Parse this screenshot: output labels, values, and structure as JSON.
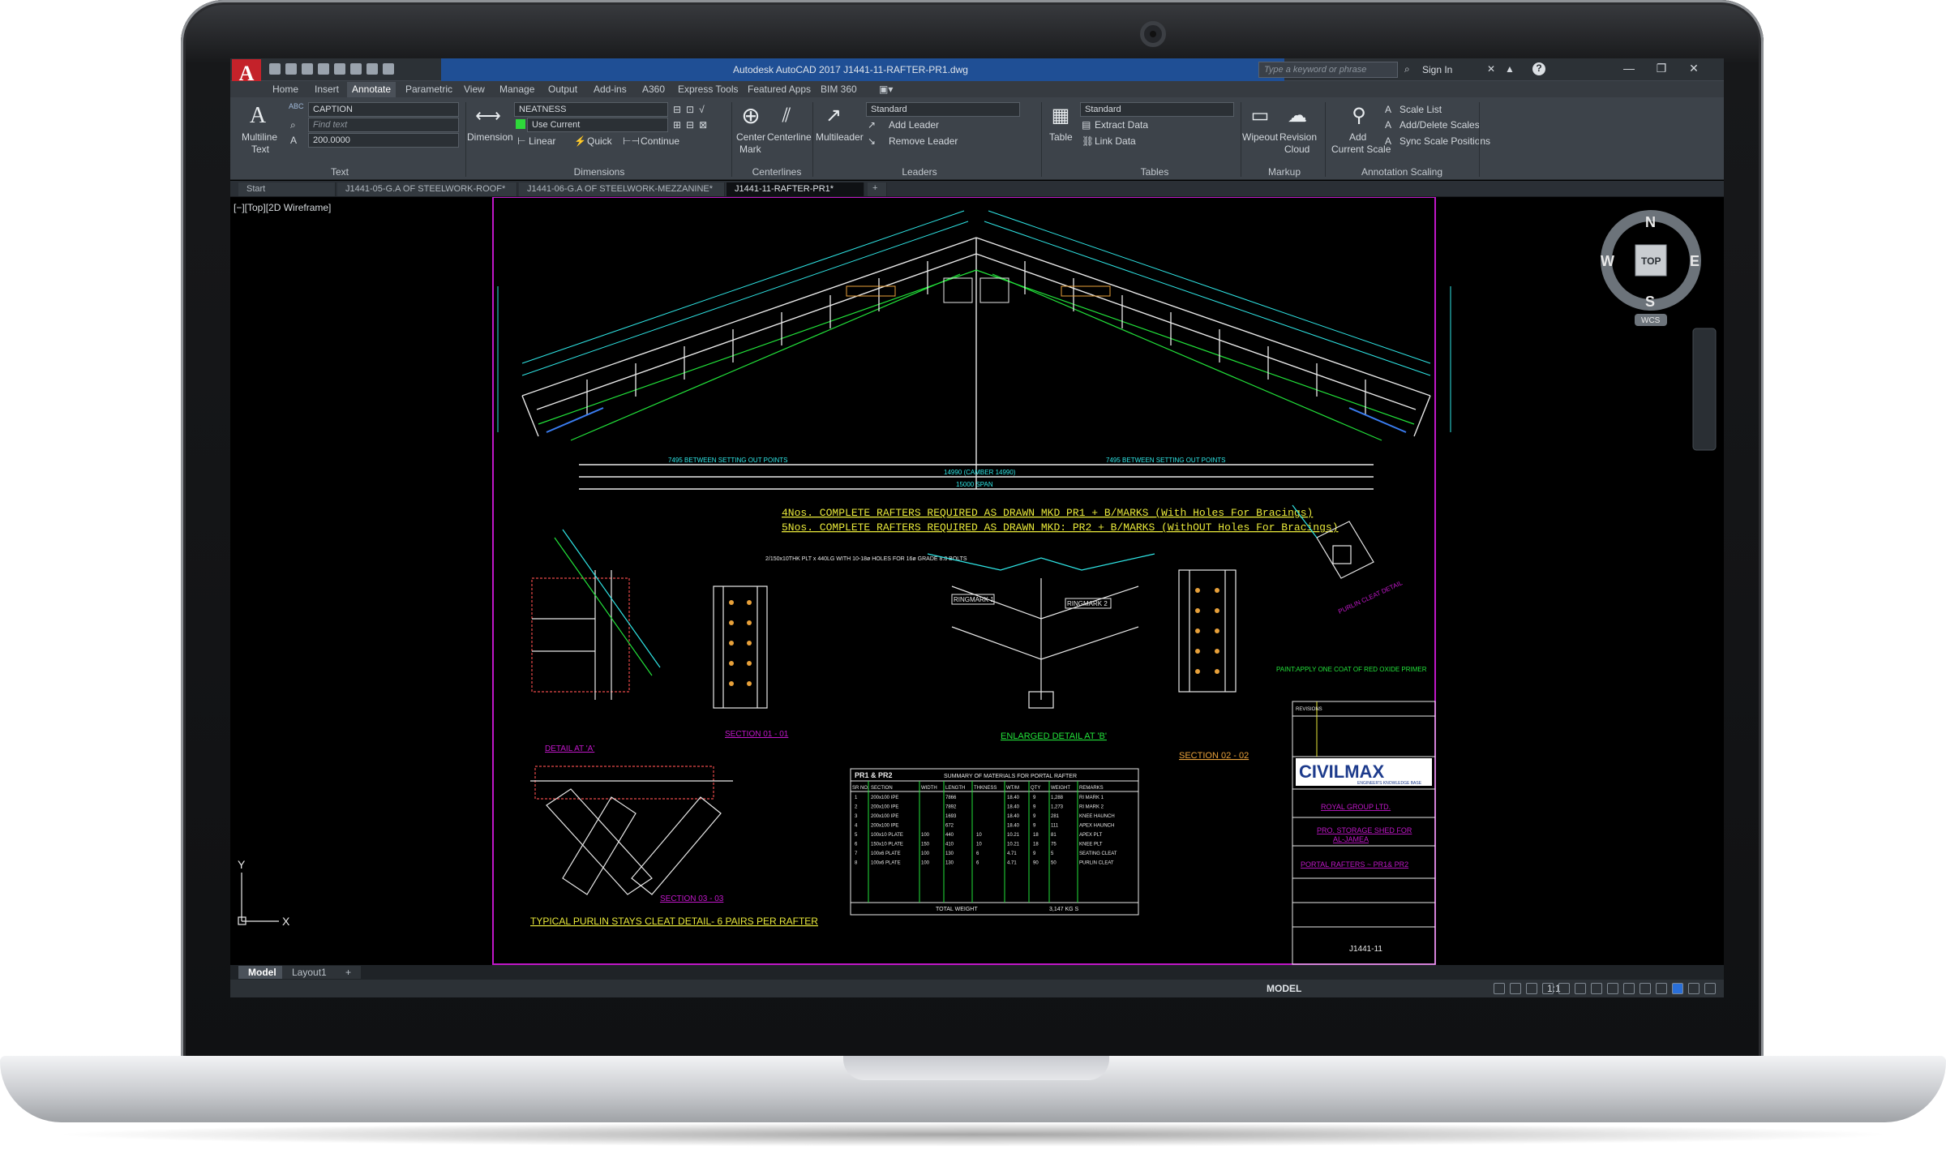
{
  "app": {
    "logo": "A",
    "title": "Autodesk AutoCAD 2017   J1441-11-RAFTER-PR1.dwg",
    "search_placeholder": "Type a keyword or phrase",
    "sign_in": "Sign In",
    "help": "?"
  },
  "menu_tabs": [
    "Home",
    "Insert",
    "Annotate",
    "Parametric",
    "View",
    "Manage",
    "Output",
    "Add-ins",
    "A360",
    "Express Tools",
    "Featured Apps",
    "BIM 360"
  ],
  "ribbon": {
    "text": {
      "multiline": "Multiline",
      "text": "Text",
      "style": "CAPTION",
      "find": "Find text",
      "height": "200.0000",
      "label": "Text"
    },
    "dimensions": {
      "dimension": "Dimension",
      "style": "NEATNESS",
      "layer": "Use Current",
      "linear": "Linear",
      "quick": "Quick",
      "continue": "Continue",
      "label": "Dimensions"
    },
    "centerlines": {
      "center_mark": "Center",
      "mark": "Mark",
      "centerline": "Centerline",
      "label": "Centerlines"
    },
    "leaders": {
      "multileader": "Multileader",
      "style": "Standard",
      "add": "Add Leader",
      "remove": "Remove Leader",
      "label": "Leaders"
    },
    "tables": {
      "table": "Table",
      "style": "Standard",
      "extract": "Extract Data",
      "link": "Link Data",
      "label": "Tables"
    },
    "markup": {
      "wipeout": "Wipeout",
      "revision": "Revision",
      "cloud": "Cloud",
      "label": "Markup"
    },
    "scaling": {
      "add": "Add",
      "current_scale": "Current Scale",
      "scale_list": "Scale List",
      "add_delete": "Add/Delete Scales",
      "sync": "Sync Scale Positions",
      "label": "Annotation Scaling"
    }
  },
  "doc_tabs": [
    "Start",
    "J1441-05-G.A OF STEELWORK-ROOF*",
    "J1441-06-G.A OF STEELWORK-MEZZANINE*",
    "J1441-11-RAFTER-PR1*"
  ],
  "viewport": {
    "label": "[−][Top][2D Wireframe]",
    "compass": {
      "n": "N",
      "s": "S",
      "e": "E",
      "w": "W",
      "top": "TOP",
      "wcs": "WCS"
    },
    "ucs": {
      "x": "X",
      "y": "Y"
    }
  },
  "drawing": {
    "note1": "4Nos. COMPLETE RAFTERS REQUIRED AS DRAWN MKD PR1 + B/MARKS (With Holes For Bracings)",
    "note2": "5Nos. COMPLETE RAFTERS REQUIRED AS DRAWN MKD: PR2 + B/MARKS (WithOUT Holes For Bracings)",
    "span": "15000 SPAN",
    "camber": "14990 (CAMBER 14990)",
    "setting_out": "7495 BETWEEN SETTING OUT POINTS",
    "detail_a": "DETAIL AT 'A'",
    "section_01": "SECTION 01 - 01",
    "enlarged_b": "ENLARGED DETAIL AT 'B'",
    "section_02": "SECTION 02 - 02",
    "section_03": "SECTION 03 - 03",
    "purlin_cleat_detail": "PURLIN CLEAT DETAIL",
    "purlin_stays": "TYPICAL PURLIN STAYS CLEAT DETAIL- 6 PAIRS PER RAFTER",
    "paint": "PAINT:APPLY ONE COAT OF RED OXIDE PRIMER",
    "ringmark1": "RINGMARK 1",
    "ringmark2": "RINGMARK 2",
    "apex_plate": "2/150x10THK PLT x 440LG WITH 10-18ø HOLES FOR 16ø GRADE 8.8 BOLTS",
    "table_title": "SUMMARY OF MATERIALS FOR PORTAL RAFTER",
    "table_tag": "PR1 & PR2",
    "table_headers": [
      "SR NO.",
      "SECTION",
      "WIDTH",
      "LENGTH",
      "THKNESS",
      "WT/M",
      "QTY",
      "WEIGHT",
      "REMARKS"
    ],
    "table_rows": [
      [
        "1",
        "200x100 IPE",
        "",
        "7866",
        "",
        "18.40",
        "9",
        "1,288",
        "RI MARK 1"
      ],
      [
        "2",
        "200x100 IPE",
        "",
        "7892",
        "",
        "18.40",
        "9",
        "1,273",
        "RI MARK 2"
      ],
      [
        "3",
        "200x100 IPE",
        "",
        "1693",
        "",
        "18.40",
        "9",
        "281",
        "KNEE HAUNCH"
      ],
      [
        "4",
        "200x100 IPE",
        "",
        "672",
        "",
        "18.40",
        "9",
        "111",
        "APEX HAUNCH"
      ],
      [
        "5",
        "100x10 PLATE",
        "100",
        "440",
        "10",
        "10.21",
        "18",
        "81",
        "APEX PLT"
      ],
      [
        "6",
        "150x10 PLATE",
        "150",
        "410",
        "10",
        "10.21",
        "18",
        "75",
        "KNEE PLT"
      ],
      [
        "7",
        "100x6 PLATE",
        "100",
        "130",
        "6",
        "4.71",
        "9",
        "5",
        "SEATING CLEAT"
      ],
      [
        "8",
        "100x6 PLATE",
        "100",
        "130",
        "6",
        "4.71",
        "90",
        "50",
        "PURLIN CLEAT"
      ]
    ],
    "total_label": "TOTAL WEIGHT",
    "total_value": "3,147 KG S",
    "title_block": {
      "logo": "CIVILMAX",
      "tagline": "ENGINEER'S KNOWLEDGE BASE",
      "client": "ROYAL GROUP LTD.",
      "project1": "PRO. STORAGE SHED FOR",
      "project2": "AL-JAMEA",
      "drawing_title": "PORTAL RAFTERS ~ PR1& PR2",
      "drawing_no": "J1441-11",
      "revisions": "REVISIONS"
    }
  },
  "layout_tabs": [
    "Model",
    "Layout1",
    "+"
  ],
  "status": {
    "model": "MODEL",
    "scale": "1:1"
  },
  "colors": {
    "drawing_green": "#22e23a",
    "cyan": "#2fe6e6",
    "yellow": "#e8e83a",
    "magenta": "#c017c8",
    "white_lines": "#e9e9e9",
    "ribbon_bg": "#3d434a",
    "title_blue": "#1f4f95"
  }
}
